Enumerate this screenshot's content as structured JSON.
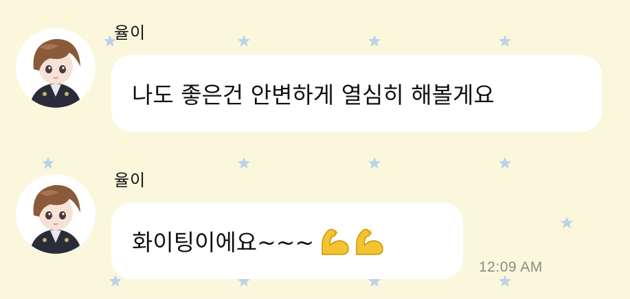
{
  "chat": {
    "messages": [
      {
        "sender": "율이",
        "text": "나도 좋은건 안변하게 열심히 해볼게요"
      },
      {
        "sender": "율이",
        "text": "화이팅이에요~~~",
        "emojis": [
          "flexed-biceps-icon",
          "flexed-biceps-icon"
        ],
        "timestamp": "12:09 AM"
      }
    ]
  },
  "colors": {
    "background": "#fbf7dc",
    "bubble": "#ffffff",
    "star": "#bcd2e8",
    "timestamp": "#8a8a8a"
  }
}
